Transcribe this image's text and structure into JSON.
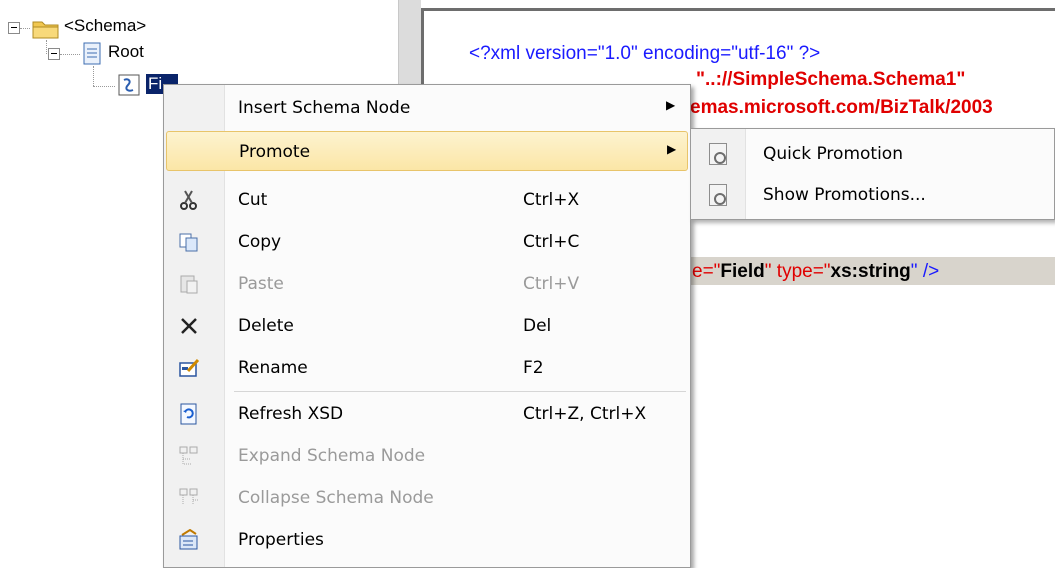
{
  "tree": {
    "schema_label": "<Schema>",
    "root_label": "Root",
    "field_label": "Fi..."
  },
  "editor": {
    "line1": "<?xml version=\"1.0\" encoding=\"utf-16\" ?>",
    "line2": "\"..://SimpleSchema.Schema1\"",
    "line3": "emas.microsoft.com/BizTalk/2003",
    "line4_pre": "e=\"",
    "line4_name": "Field",
    "line4_mid": "\" type=\"",
    "line4_type": "xs:string",
    "line4_post": "\" />"
  },
  "menu": {
    "items": [
      {
        "label": "Insert Schema Node",
        "shortcut": "",
        "submenu": true,
        "icon": "",
        "disabled": false
      },
      {
        "label": "Promote",
        "shortcut": "",
        "submenu": true,
        "icon": "",
        "disabled": false
      },
      {
        "label": "Cut",
        "shortcut": "Ctrl+X",
        "icon": "scissors-icon",
        "disabled": false
      },
      {
        "label": "Copy",
        "shortcut": "Ctrl+C",
        "icon": "copy-icon",
        "disabled": false
      },
      {
        "label": "Paste",
        "shortcut": "Ctrl+V",
        "icon": "paste-icon",
        "disabled": true
      },
      {
        "label": "Delete",
        "shortcut": "Del",
        "icon": "delete-icon",
        "disabled": false
      },
      {
        "label": "Rename",
        "shortcut": "F2",
        "icon": "rename-icon",
        "disabled": false
      },
      {
        "label": "Refresh XSD",
        "shortcut": "Ctrl+Z, Ctrl+X",
        "icon": "refresh-icon",
        "disabled": false
      },
      {
        "label": "Expand Schema Node",
        "shortcut": "",
        "icon": "expand-node-icon",
        "disabled": true
      },
      {
        "label": "Collapse Schema Node",
        "shortcut": "",
        "icon": "collapse-node-icon",
        "disabled": true
      },
      {
        "label": "Properties",
        "shortcut": "",
        "icon": "properties-icon",
        "disabled": false
      }
    ],
    "arrow": "▶"
  },
  "submenu": {
    "items": [
      {
        "label": "Quick Promotion",
        "icon": "promotion-icon"
      },
      {
        "label": "Show Promotions...",
        "icon": "promotion-icon"
      }
    ]
  },
  "colors": {
    "selection": "#0a246a",
    "xml_blue": "#1a1aff",
    "xml_red": "#e00000",
    "menu_hover": "#fbe6a6"
  }
}
